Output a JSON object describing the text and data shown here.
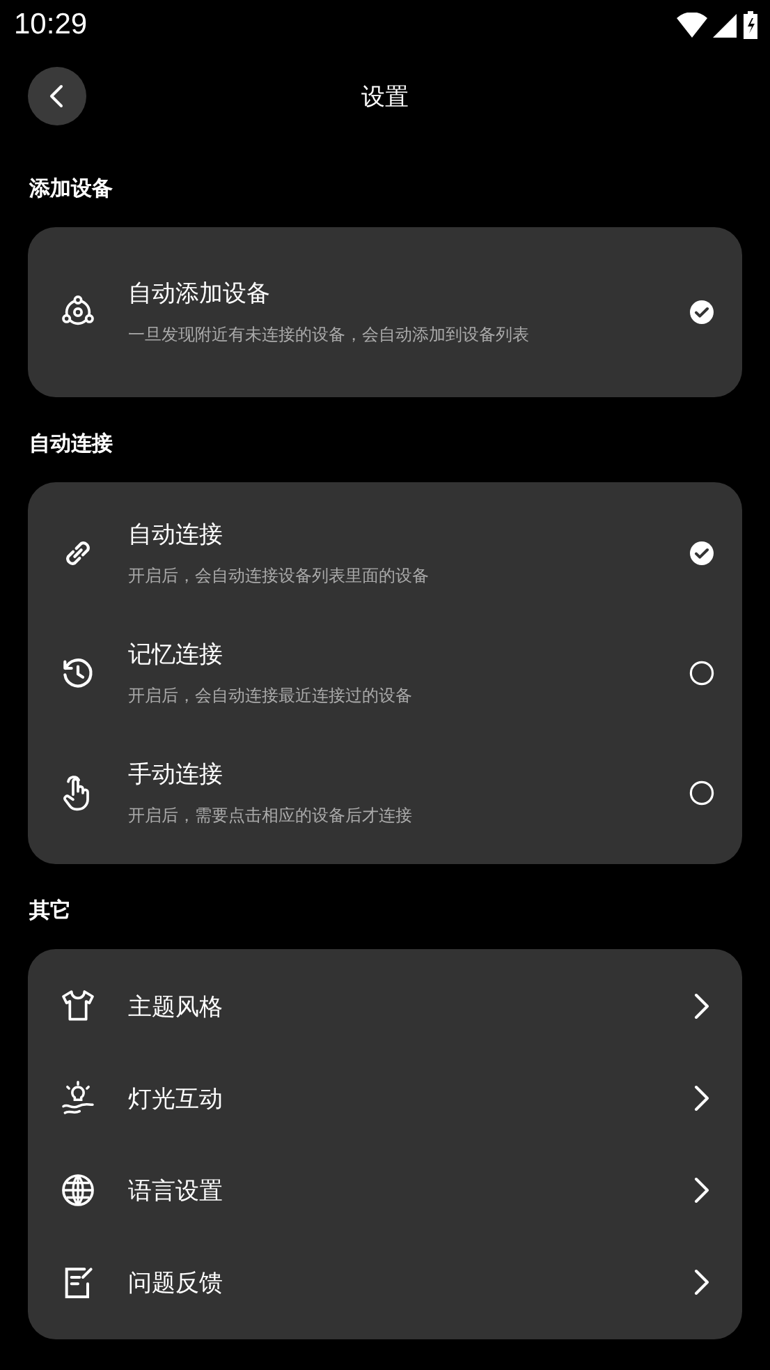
{
  "status_bar": {
    "time": "10:29"
  },
  "header": {
    "title": "设置"
  },
  "sections": [
    {
      "label": "添加设备",
      "items": [
        {
          "kind": "check",
          "title": "自动添加设备",
          "subtitle": "一旦发现附近有未连接的设备，会自动添加到设备列表",
          "checked": true
        }
      ]
    },
    {
      "label": "自动连接",
      "items": [
        {
          "kind": "radio",
          "title": "自动连接",
          "subtitle": "开启后，会自动连接设备列表里面的设备",
          "selected": true
        },
        {
          "kind": "radio",
          "title": "记忆连接",
          "subtitle": "开启后，会自动连接最近连接过的设备",
          "selected": false
        },
        {
          "kind": "radio",
          "title": "手动连接",
          "subtitle": "开启后，需要点击相应的设备后才连接",
          "selected": false
        }
      ]
    },
    {
      "label": "其它",
      "items": [
        {
          "kind": "link",
          "title": "主题风格"
        },
        {
          "kind": "link",
          "title": "灯光互动"
        },
        {
          "kind": "link",
          "title": "语言设置"
        },
        {
          "kind": "link",
          "title": "问题反馈"
        }
      ]
    }
  ]
}
